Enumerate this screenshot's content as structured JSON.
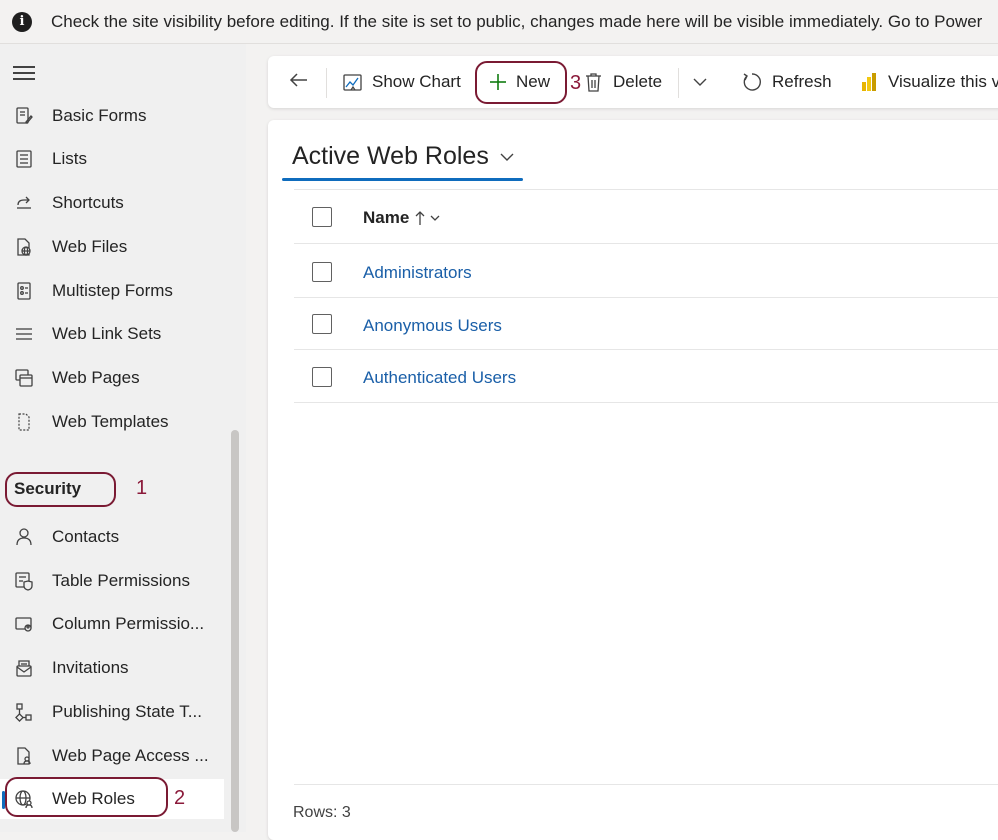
{
  "banner": {
    "icon": "info-icon",
    "text": "Check the site visibility before editing. If the site is set to public, changes made here will be visible immediately. Go to Power"
  },
  "sidebar": {
    "menu_icon": "hamburger-icon",
    "items_top": [
      {
        "label": "Basic Forms",
        "icon": "form-icon"
      },
      {
        "label": "Lists",
        "icon": "list-icon"
      },
      {
        "label": "Shortcuts",
        "icon": "shortcut-icon"
      },
      {
        "label": "Web Files",
        "icon": "web-file-icon"
      },
      {
        "label": "Multistep Forms",
        "icon": "multistep-form-icon"
      },
      {
        "label": "Web Link Sets",
        "icon": "link-set-icon"
      },
      {
        "label": "Web Pages",
        "icon": "web-pages-icon"
      },
      {
        "label": "Web Templates",
        "icon": "template-icon"
      }
    ],
    "section_title": "Security",
    "items_security": [
      {
        "label": "Contacts",
        "icon": "person-icon"
      },
      {
        "label": "Table Permissions",
        "icon": "table-permission-icon"
      },
      {
        "label": "Column Permissio...",
        "icon": "column-permission-icon"
      },
      {
        "label": "Invitations",
        "icon": "invitation-icon"
      },
      {
        "label": "Publishing State T...",
        "icon": "workflow-icon"
      },
      {
        "label": "Web Page Access ...",
        "icon": "page-access-icon"
      },
      {
        "label": "Web Roles",
        "icon": "web-roles-icon",
        "selected": true
      }
    ]
  },
  "annotations": {
    "one": "1",
    "two": "2",
    "three": "3",
    "color": "#7a1a33"
  },
  "toolbar": {
    "back_icon": "back-arrow-icon",
    "show_chart": "Show Chart",
    "new": "New",
    "delete": "Delete",
    "refresh": "Refresh",
    "visualize": "Visualize this view"
  },
  "view": {
    "title": "Active Web Roles",
    "column_name": "Name",
    "rows": [
      "Administrators",
      "Anonymous Users",
      "Authenticated Users"
    ],
    "rows_count": "Rows: 3"
  },
  "colors": {
    "accent": "#0f6cbd",
    "link": "#1a5fa8",
    "new_plus": "#107c10"
  }
}
